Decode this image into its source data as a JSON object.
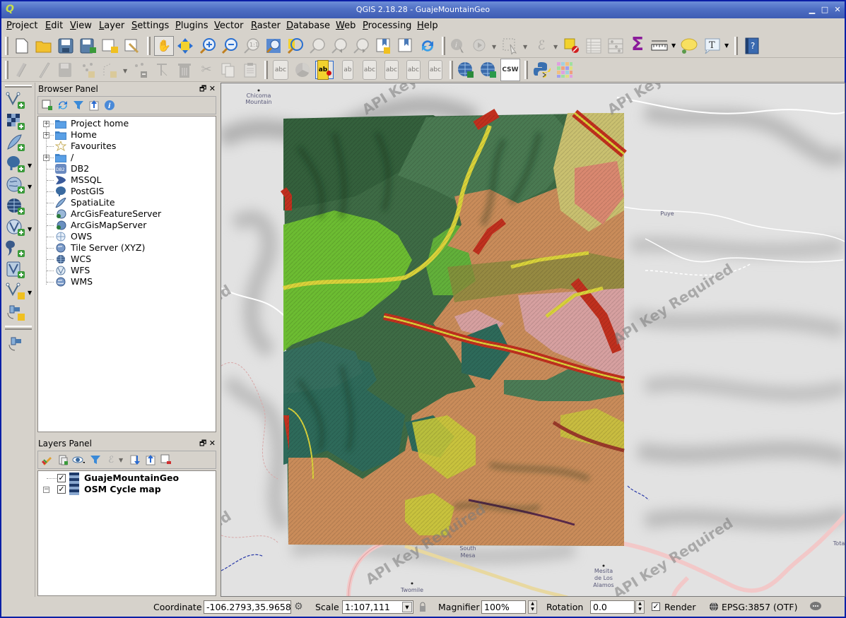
{
  "window": {
    "title": "QGIS 2.18.28 - GuajeMountainGeo",
    "app_icon": "qgis-logo-icon",
    "controls": [
      "minimize",
      "maximize",
      "close"
    ]
  },
  "menubar": {
    "items": [
      "Project",
      "Edit",
      "View",
      "Layer",
      "Settings",
      "Plugins",
      "Vector",
      "Raster",
      "Database",
      "Web",
      "Processing",
      "Help"
    ]
  },
  "toolbar_row1": {
    "file": [
      "new-project-icon",
      "open-project-icon",
      "save-project-icon",
      "save-as-icon",
      "new-print-composer-icon",
      "composer-manager-icon"
    ],
    "navigation": [
      "pan-icon",
      "pan-to-selection-icon",
      "zoom-in-icon",
      "zoom-out-icon",
      "zoom-native-icon",
      "zoom-full-icon",
      "zoom-to-selection-icon",
      "zoom-to-layer-icon",
      "zoom-last-icon",
      "zoom-next-icon",
      "new-bookmark-icon",
      "show-bookmarks-icon",
      "refresh-icon"
    ],
    "attributes": [
      "identify-icon",
      "run-action-icon",
      "select-features-icon",
      "select-by-expression-icon",
      "deselect-icon",
      "attribute-table-icon",
      "field-calculator-icon",
      "statistical-summary-icon",
      "measure-icon",
      "map-tips-icon",
      "text-annotation-icon"
    ],
    "help": [
      "whats-this-help-icon"
    ]
  },
  "toolbar_row2": {
    "digitizing": [
      "current-edits-icon",
      "toggle-editing-icon",
      "save-edits-icon",
      "add-feature-icon",
      "vertex-tool-icon",
      "move-feature-icon",
      "node-tool-icon",
      "delete-selected-icon",
      "cut-features-icon",
      "copy-features-icon",
      "paste-features-icon"
    ],
    "labels": [
      "layer-labeling-icon",
      "layer-diagram-icon",
      "pin-labels-icon",
      "highlight-pinned-labels-icon",
      "show-hide-labels-icon",
      "move-label-icon",
      "rotate-label-icon",
      "change-label-icon"
    ],
    "web": [
      "metasearch-icon",
      "csw-icon"
    ],
    "plugins": [
      "python-console-icon",
      "color-grid-icon"
    ],
    "csw_label": "CSW"
  },
  "left_toolbar": {
    "items": [
      "add-vector-layer-icon",
      "add-raster-layer-icon",
      "add-spatialite-layer-icon",
      "add-postgis-layer-icon",
      "add-wms-layer-icon",
      "add-wcs-layer-icon",
      "add-wfs-layer-icon",
      "add-delimited-text-icon",
      "add-virtual-layer-icon",
      "new-shapefile-icon",
      "add-gps-layer-icon",
      "gps-info-icon"
    ]
  },
  "browser_panel": {
    "title": "Browser Panel",
    "tools": [
      "add-selected-layers-icon",
      "refresh-icon",
      "filter-icon",
      "collapse-all-icon",
      "properties-icon"
    ],
    "items": [
      {
        "label": "Project home",
        "icon": "folder-icon",
        "expandable": true
      },
      {
        "label": "Home",
        "icon": "folder-icon",
        "expandable": true
      },
      {
        "label": "Favourites",
        "icon": "star-icon",
        "expandable": false
      },
      {
        "label": "/",
        "icon": "folder-icon",
        "expandable": true
      },
      {
        "label": "DB2",
        "icon": "db2-icon",
        "expandable": false
      },
      {
        "label": "MSSQL",
        "icon": "mssql-icon",
        "expandable": false
      },
      {
        "label": "PostGIS",
        "icon": "postgis-icon",
        "expandable": false
      },
      {
        "label": "SpatiaLite",
        "icon": "spatialite-icon",
        "expandable": false
      },
      {
        "label": "ArcGisFeatureServer",
        "icon": "arcgis-feature-server-icon",
        "expandable": false
      },
      {
        "label": "ArcGisMapServer",
        "icon": "arcgis-map-server-icon",
        "expandable": false
      },
      {
        "label": "OWS",
        "icon": "ows-icon",
        "expandable": false
      },
      {
        "label": "Tile Server (XYZ)",
        "icon": "xyz-tile-icon",
        "expandable": false
      },
      {
        "label": "WCS",
        "icon": "wcs-icon",
        "expandable": false
      },
      {
        "label": "WFS",
        "icon": "wfs-icon",
        "expandable": false
      },
      {
        "label": "WMS",
        "icon": "wms-icon",
        "expandable": false
      }
    ],
    "db2_badge": "DB2"
  },
  "layers_panel": {
    "title": "Layers Panel",
    "tools": [
      "style-manager-icon",
      "add-group-icon",
      "manage-visibility-icon",
      "filter-legend-icon",
      "filter-by-expression-icon",
      "expand-all-icon",
      "collapse-all-icon",
      "remove-layer-icon"
    ],
    "layers": [
      {
        "name": "GuajeMountainGeo",
        "visible": true,
        "type": "raster"
      },
      {
        "name": "OSM Cycle map",
        "visible": true,
        "type": "raster"
      }
    ]
  },
  "map": {
    "watermark": "API Key Required",
    "place_labels": [
      "Chicoma Mountain",
      "Puye",
      "South Mesa",
      "Mesita de Los Alamos",
      "Twomile",
      "Totavi"
    ],
    "colors": {
      "basemap": "#e2e2e2",
      "geo_dark_green": "#3e6b45",
      "geo_teal": "#2f6b5b",
      "geo_lime": "#6fbf2e",
      "geo_tan": "#c98c5a",
      "geo_red": "#c0301e",
      "geo_yellow": "#d9d23a",
      "geo_pink": "#d6a0a0",
      "geo_olive": "#8a8a3c",
      "geo_khaki": "#c9c070"
    }
  },
  "statusbar": {
    "coordinate_label": "Coordinate",
    "coordinate_value": "-106.2793,35.9658",
    "scale_label": "Scale",
    "scale_value": "1:107,111",
    "magnifier_label": "Magnifier",
    "magnifier_value": "100%",
    "rotation_label": "Rotation",
    "rotation_value": "0.0",
    "render_label": "Render",
    "render_checked": true,
    "crs_label": "EPSG:3857 (OTF)"
  }
}
